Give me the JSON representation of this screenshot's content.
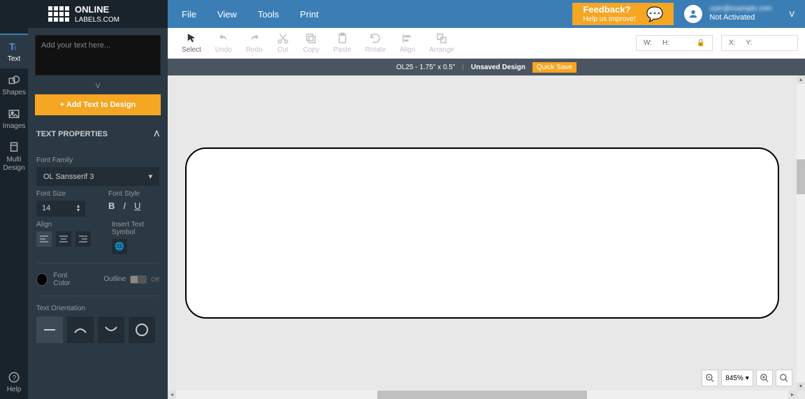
{
  "brand": "ONLINE LABELS .COM",
  "menu": {
    "file": "File",
    "view": "View",
    "tools": "Tools",
    "print": "Print"
  },
  "feedback": {
    "title": "Feedback?",
    "sub": "Help us improve!"
  },
  "user": {
    "email": "user@example.com",
    "status": "Not Activated"
  },
  "leftnav": {
    "text": "Text",
    "shapes": "Shapes",
    "images": "Images",
    "multi1": "Multi",
    "multi2": "Design",
    "help": "Help"
  },
  "panel": {
    "placeholder": "Add your text here...",
    "add_btn": "+ Add Text to Design",
    "props": "TEXT PROPERTIES",
    "font_family_label": "Font Family",
    "font_family": "OL Sansserif 3",
    "font_size_label": "Font Size",
    "font_size": "14",
    "font_style_label": "Font Style",
    "align_label": "Align",
    "symbol_label": "Insert Text Symbol",
    "font_color_label": "Font Color",
    "outline_label": "Outline",
    "outline_state": "Off",
    "orient_label": "Text Orientation"
  },
  "toolbar": {
    "select": "Select",
    "undo": "Undo",
    "redo": "Redo",
    "cut": "Cut",
    "copy": "Copy",
    "paste": "Paste",
    "rotate": "Rotate",
    "align": "Align",
    "arrange": "Arrange"
  },
  "dims": {
    "w": "W:",
    "h": "H:",
    "x": "X:",
    "y": "Y:"
  },
  "status": {
    "product": "OL25 - 1.75\" x 0.5\"",
    "design": "Unsaved Design",
    "quick_save": "Quick Save"
  },
  "zoom": "845%"
}
